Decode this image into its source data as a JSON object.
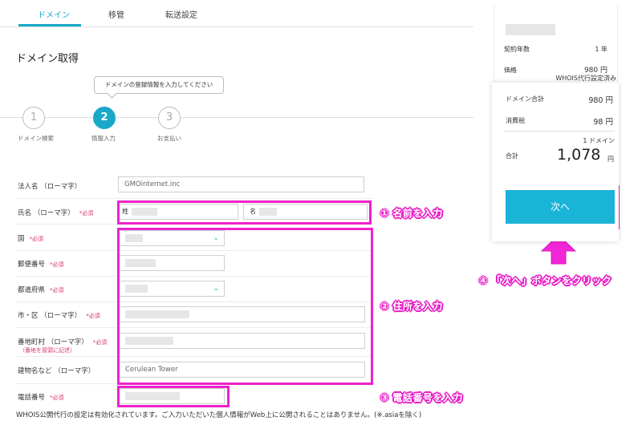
{
  "tabs": [
    {
      "label": "ドメイン",
      "active": true
    },
    {
      "label": "移管",
      "active": false
    },
    {
      "label": "転送設定",
      "active": false
    }
  ],
  "page_title": "ドメイン取得",
  "stepper": {
    "tooltip": "ドメインの登録情報を入力してください",
    "steps": [
      {
        "number": "1",
        "label": "ドメイン検索"
      },
      {
        "number": "2",
        "label": "情報入力"
      },
      {
        "number": "3",
        "label": "お支払い"
      }
    ]
  },
  "form": {
    "required_mark": "*必須",
    "corp_name": {
      "label": "法人名 （ローマ字）",
      "value": "GMOinternet.inc"
    },
    "full_name": {
      "label": "氏名 （ローマ字）",
      "last_prefix": "姓",
      "first_prefix": "名"
    },
    "country": {
      "label": "国"
    },
    "postal": {
      "label": "郵便番号"
    },
    "prefecture": {
      "label": "都道府県"
    },
    "city": {
      "label": "市・区 （ローマ字）"
    },
    "street": {
      "label": "番地町村 （ローマ字）",
      "note": "（番地を冒頭に記述）"
    },
    "building": {
      "label": "建物名など （ローマ字）",
      "value": "Cerulean Tower"
    },
    "phone": {
      "label": "電話番号"
    }
  },
  "footer_note": "WHOIS公開代行の設定は有効化されています。ご入力いただいた個人情報がWeb上に公開されることはありません。(※.asiaを除く)",
  "side": {
    "contract_label": "契約年数",
    "contract_value": "1 年",
    "price_label": "価格",
    "price_value": "980 円",
    "whois_note": "WHOIS代行設定済み",
    "domain_total_label": "ドメイン合計",
    "domain_total_value": "980 円",
    "tax_label": "消費税",
    "tax_value": "98 円",
    "count": "1 ドメイン",
    "total_label": "合計",
    "total_value": "1,078",
    "total_unit": "円",
    "next_button": "次へ"
  },
  "annotations": {
    "name": "① 名前を入力",
    "address": "② 住所を入力",
    "phone": "③ 電話番号を入力",
    "next": "④ 「次へ」ボタンをクリック"
  },
  "colors": {
    "accent": "#1aa8c9",
    "button": "#1ab4d6",
    "highlight": "#ee22cc",
    "required": "#d6336c"
  }
}
